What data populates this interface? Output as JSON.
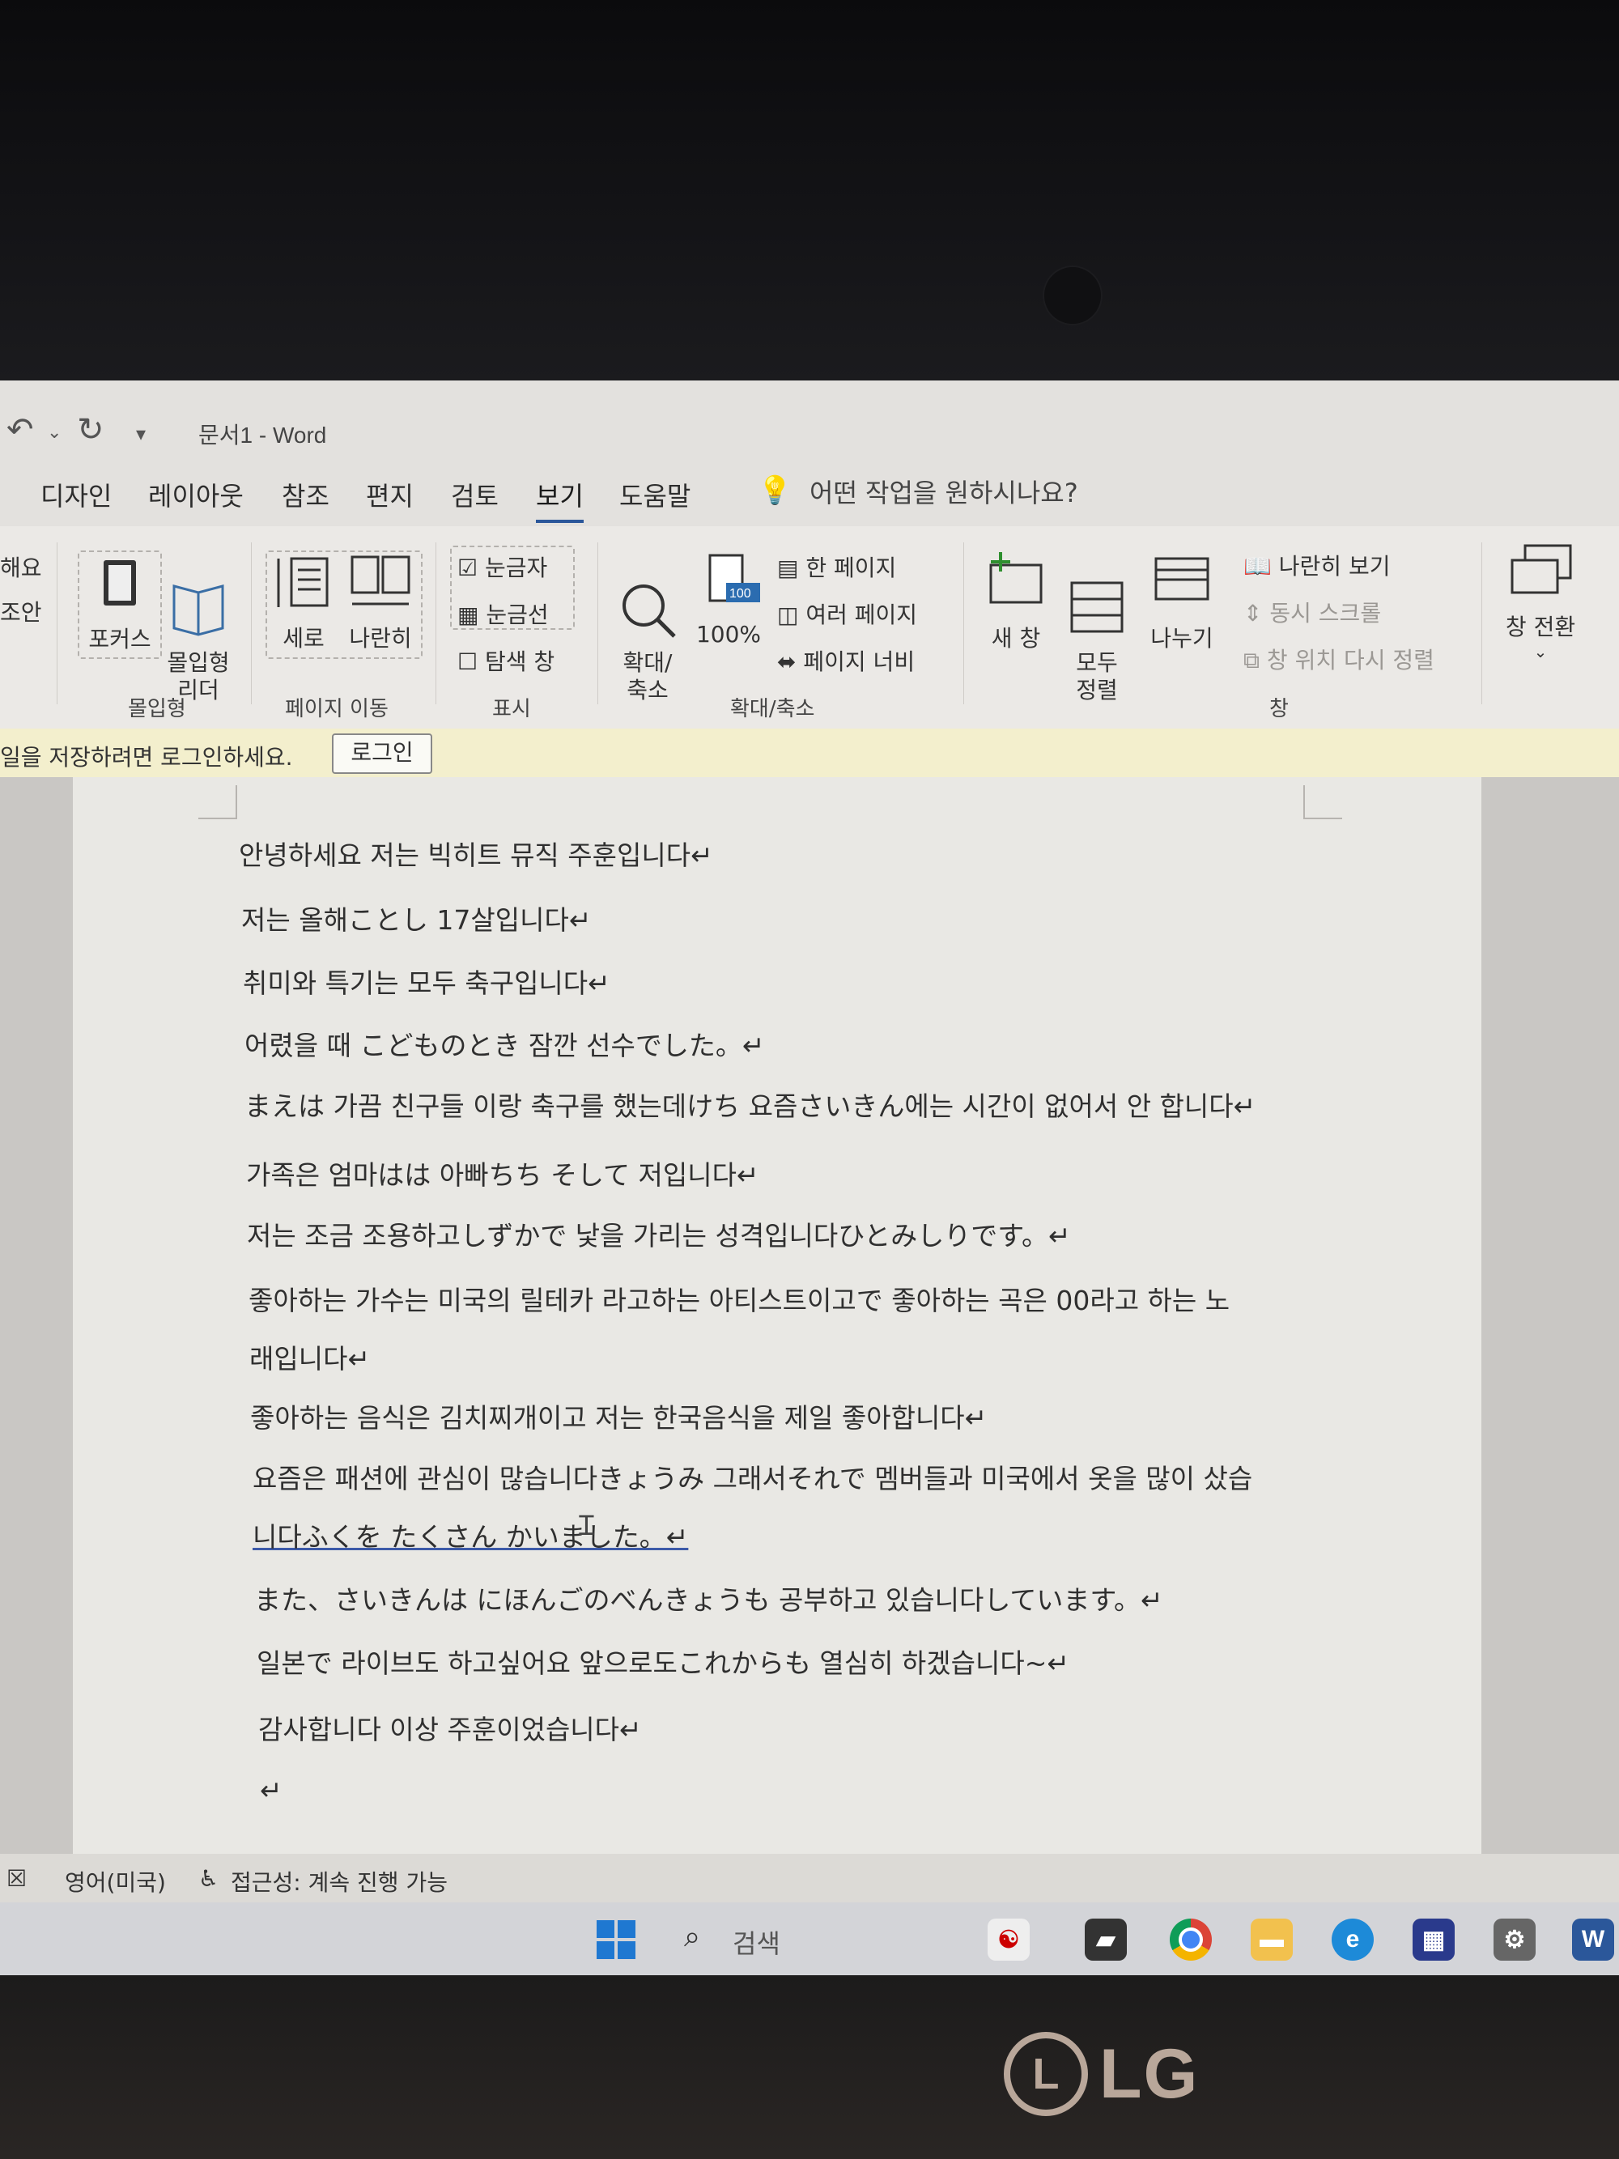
{
  "titlebar": {
    "undo_icon": "undo-icon",
    "redo_icon": "redo-icon",
    "customize_icon": "customize-quick-access-icon",
    "title": "문서1  -  Word"
  },
  "menu": {
    "tabs": [
      {
        "label": "디자인"
      },
      {
        "label": "레이아웃"
      },
      {
        "label": "참조"
      },
      {
        "label": "편지"
      },
      {
        "label": "검토"
      },
      {
        "label": "보기"
      },
      {
        "label": "도움말"
      }
    ],
    "active_tab": "보기",
    "tell_me": "어떤 작업을 원하시나요?"
  },
  "ribbon": {
    "partial_left_top": "해요",
    "partial_left_bottom": "조안",
    "focus": "포커스",
    "immersive_reader": "몰입형\n리더",
    "group_immersive": "몰입형",
    "vertical": "세로",
    "side_to_side": "나란히",
    "group_page_move": "페이지 이동",
    "ruler": "눈금자",
    "gridlines": "눈금선",
    "nav_pane": "탐색 창",
    "group_show": "표시",
    "zoom": "확대/\n축소",
    "zoom_100": "100%",
    "one_page": "한 페이지",
    "multiple_pages": "여러 페이지",
    "page_width": "페이지 너비",
    "group_zoom": "확대/축소",
    "new_window": "새 창",
    "arrange_all": "모두\n정렬",
    "split": "나누기",
    "view_side_by_side": "나란히 보기",
    "sync_scroll": "동시 스크롤",
    "reset_position": "창 위치 다시 정렬",
    "group_window": "창",
    "switch_windows": "창 전환"
  },
  "message_bar": {
    "text": "일을 저장하려면 로그인하세요.",
    "button": "로그인"
  },
  "document": {
    "lines": [
      "안녕하세요  저는  빅히트  뮤직  주훈입니다↵",
      "저는  올해ことし  17살입니다↵",
      "취미와  특기는  모두  축구입니다↵",
      "어렸을  때  こどものとき  잠깐  선수でした。↵",
      "まえは  가끔  친구들  이랑  축구를  했는데けち  요즘さいきん에는  시간이  없어서  안  합니다↵",
      "가족은  엄마はは  아빠ちち    そして  저입니다↵",
      "저는  조금  조용하고しずかで  낯을  가리는  성격입니다ひとみしりです。↵",
      "좋아하는  가수는  미국의  릴테카  라고하는  아티스트이고で  좋아하는  곡은  00라고  하는  노",
      "래입니다↵",
      "좋아하는  음식은  김치찌개이고  저는  한국음식을  제일  좋아합니다↵",
      "요즘은  패션에  관심이  많습니다きょうみ  그래서それで  멤버들과  미국에서  옷을  많이  샀습",
      "니다ふくを  たくさん  かいました。↵",
      "また、さいきんは  にほんごのべんきょうも  공부하고  있습니다しています。↵",
      "일본で  라이브도  하고싶어요  앞으로도これからも  열심히  하겠습니다~↵",
      "감사합니다  이상  주훈이었습니다↵",
      "↵"
    ]
  },
  "statusbar": {
    "language": "영어(미국)",
    "accessibility": "접근성: 계속 진행 가능"
  },
  "taskbar": {
    "search": "검색"
  }
}
